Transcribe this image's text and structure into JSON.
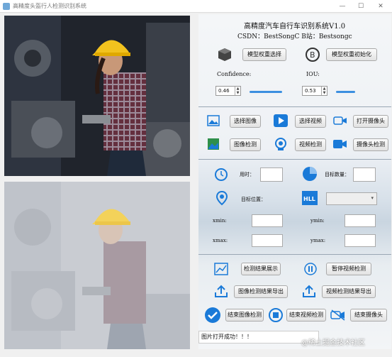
{
  "window": {
    "title": "高精度头盔行人检测识别系统",
    "min": "—",
    "max": "☐",
    "close": "✕"
  },
  "header": {
    "title": "高精度汽车自行车识别系统V1.0",
    "csdn": "CSDN：BestSongC  B站：Bestsongc"
  },
  "buttons": {
    "model_select": "模型权重选择",
    "model_init": "模型权重初始化",
    "select_image": "选择图像",
    "select_video": "选择视频",
    "open_camera": "打开摄像头",
    "image_detect": "图像检测",
    "video_detect": "视频检测",
    "camera_detect": "摄像头检测",
    "show_result": "检测结果展示",
    "pause_video": "暂停视频检测",
    "export_image": "图像检测结果导出",
    "export_video": "视频检测结果导出",
    "stop_image": "结束图像检测",
    "stop_video": "结束视频检测",
    "stop_camera": "结束摄像头"
  },
  "params": {
    "confidence_label": "Confidence:",
    "confidence_value": "0.46",
    "confidence_fraction": 0.46,
    "iou_label": "IOU:",
    "iou_value": "0.53",
    "iou_fraction": 0.53
  },
  "info": {
    "time_label": "用时：",
    "count_label": "目标数量：",
    "pos_label": "目标位置：",
    "xmin": "xmin:",
    "ymin": "ymin:",
    "xmax": "xmax:",
    "ymax": "ymax:",
    "time_value": "",
    "count_value": "",
    "xmin_value": "",
    "ymin_value": "",
    "xmax_value": "",
    "ymax_value": "",
    "target_select": ""
  },
  "status": "图片打开成功！！！",
  "watermark": "@稀土掘金技术社区",
  "colors": {
    "accent": "#3c8fe0",
    "panel_bg": "#eef1f5"
  },
  "icons": [
    "cube-icon",
    "b-icon",
    "image-icon",
    "play-icon",
    "camera-icon",
    "gallery-icon",
    "target-icon",
    "video-camera-icon",
    "timer-icon",
    "pie-chart-icon",
    "location-icon",
    "hll-icon",
    "line-chart-icon",
    "pause-icon",
    "upload-icon",
    "check-icon",
    "stop-icon",
    "camera-off-icon"
  ]
}
